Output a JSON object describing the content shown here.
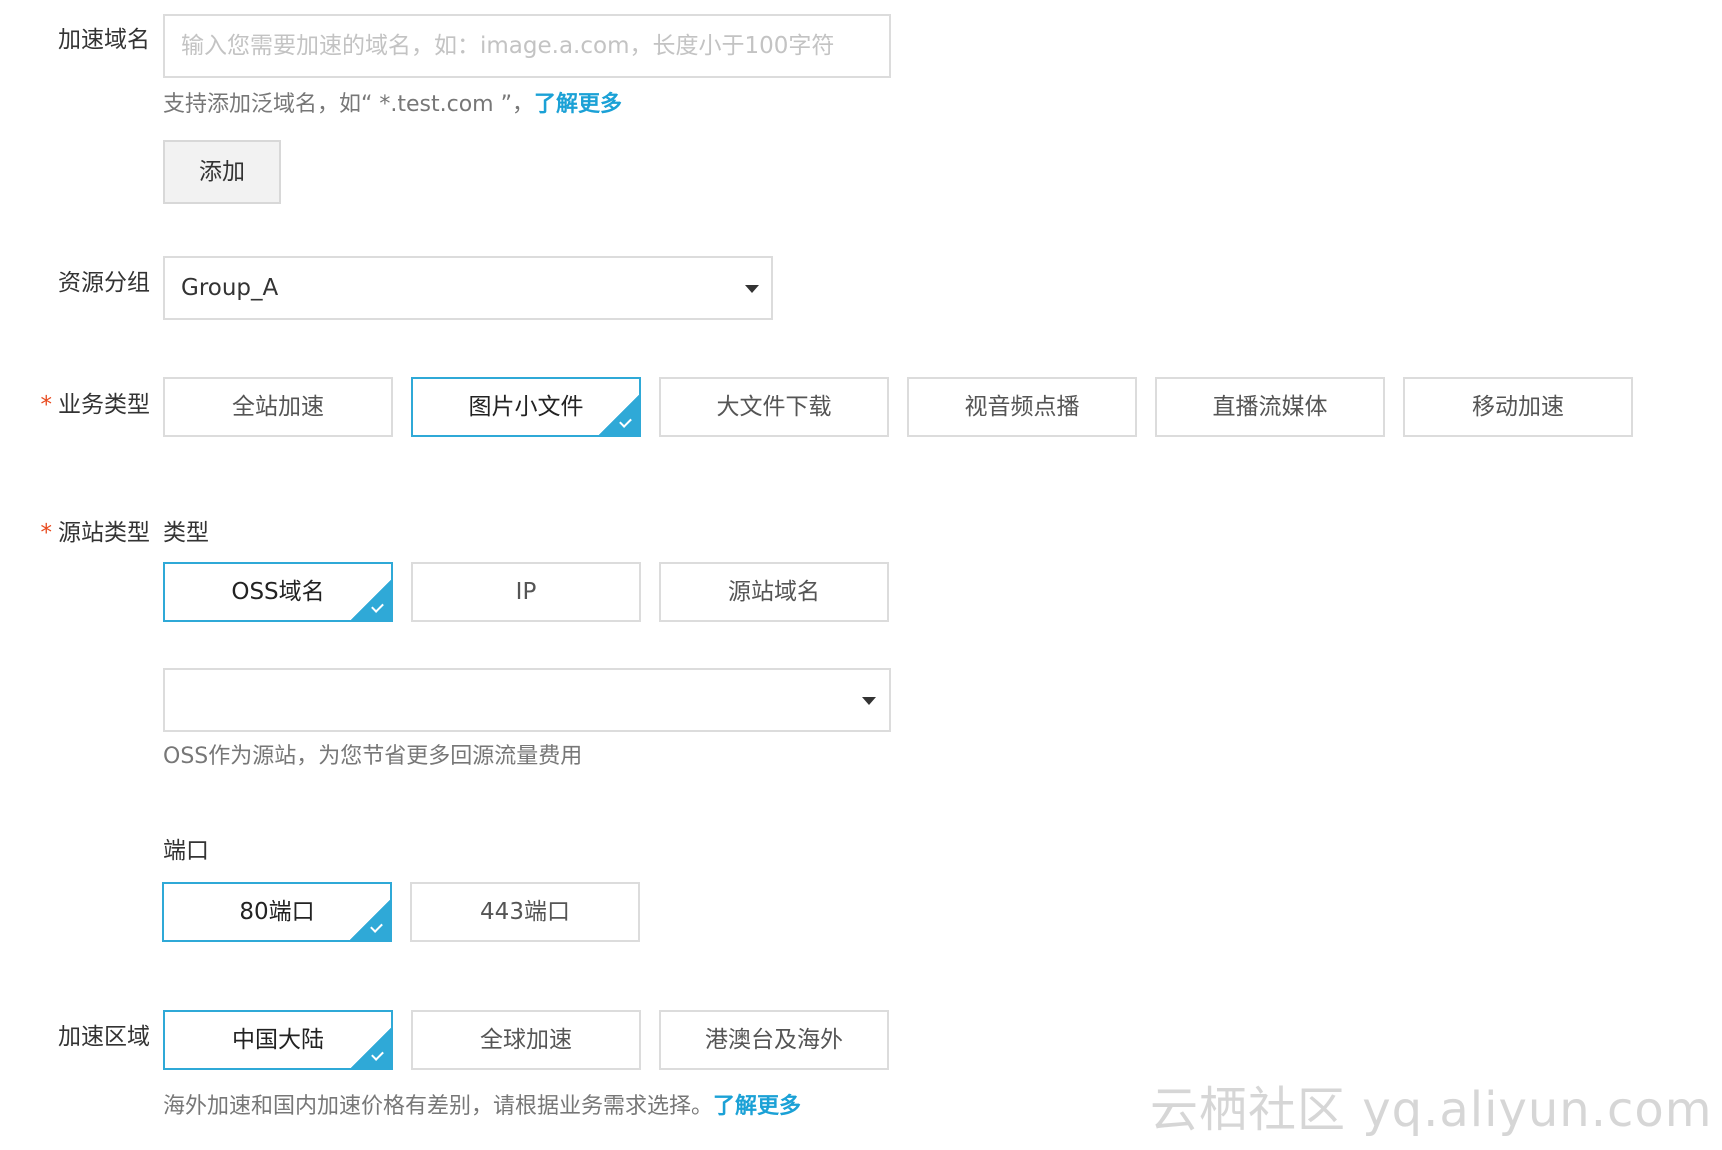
{
  "domain_field": {
    "label": "加速域名",
    "placeholder": "输入您需要加速的域名，如：image.a.com，长度小于100字符",
    "hint_text": "支持添加泛域名，如“ *.test.com ”，",
    "hint_link": "了解更多",
    "add_button": "添加"
  },
  "resource_group": {
    "label": "资源分组",
    "value": "Group_A"
  },
  "business_type": {
    "required_mark": "*",
    "label": "业务类型",
    "options": [
      "全站加速",
      "图片小文件",
      "大文件下载",
      "视音频点播",
      "直播流媒体",
      "移动加速"
    ],
    "selected_index": 1
  },
  "origin_type": {
    "required_mark": "*",
    "label": "源站类型",
    "type_label": "类型",
    "options": [
      "OSS域名",
      "IP",
      "源站域名"
    ],
    "selected_index": 0,
    "select_value": "",
    "hint": "OSS作为源站，为您节省更多回源流量费用"
  },
  "port": {
    "label": "端口",
    "options": [
      "80端口",
      "443端口"
    ],
    "selected_index": 0
  },
  "region": {
    "label": "加速区域",
    "options": [
      "中国大陆",
      "全球加速",
      "港澳台及海外"
    ],
    "selected_index": 0,
    "hint_text": "海外加速和国内加速价格有差别，请根据业务需求选择。",
    "hint_link": "了解更多"
  },
  "watermark": "云栖社区 yq.aliyun.com",
  "colors": {
    "accent": "#2fa9d7",
    "link": "#1ba1d6",
    "required": "#e8491d"
  }
}
